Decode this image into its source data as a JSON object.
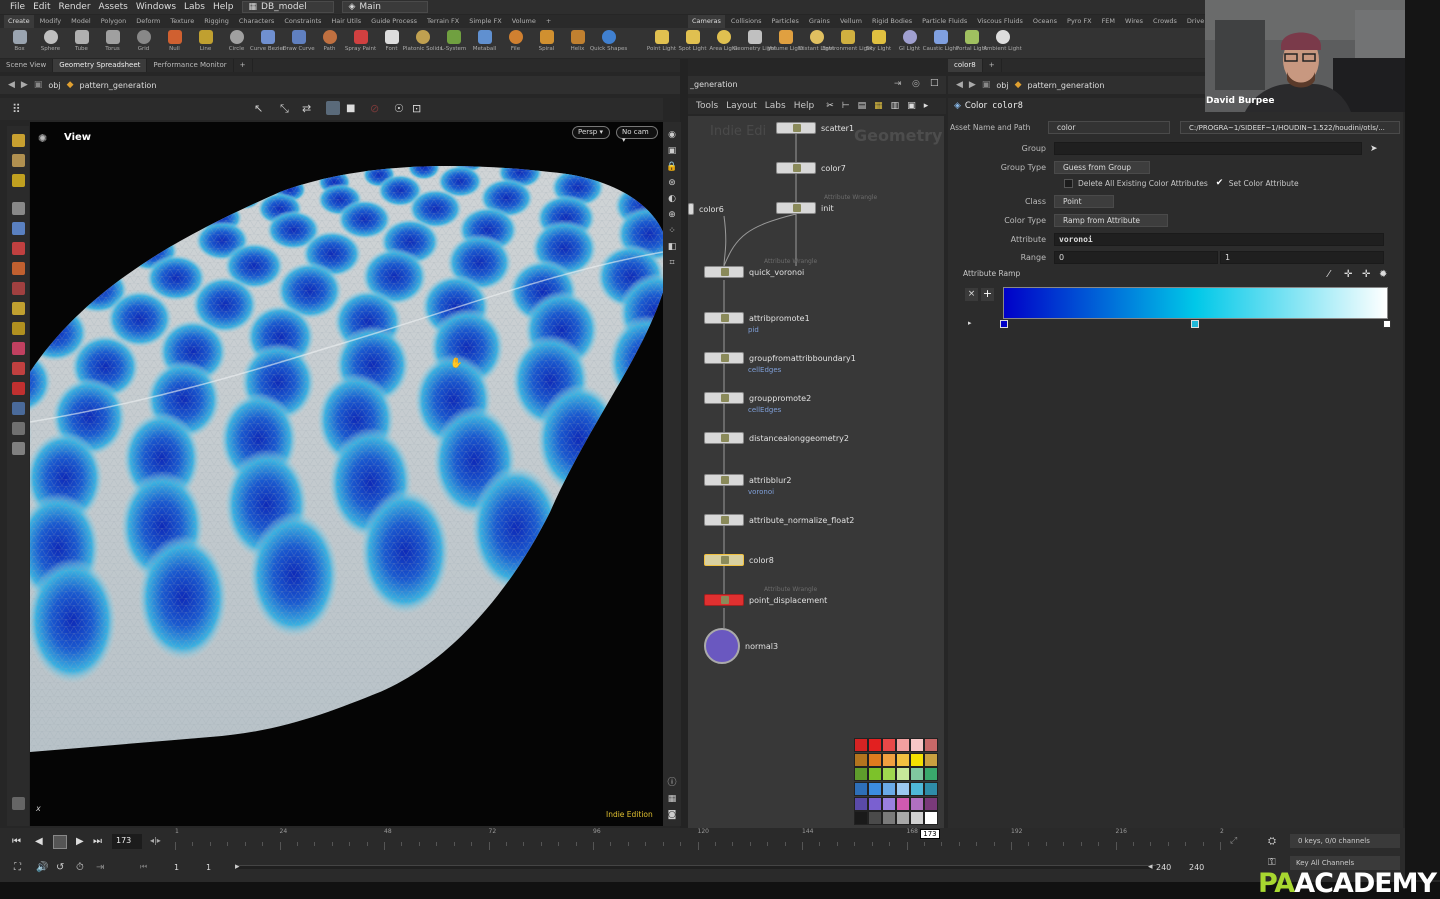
{
  "menubar": {
    "items": [
      "File",
      "Edit",
      "Render",
      "Assets",
      "Windows",
      "Labs",
      "Help"
    ],
    "desktop": "DB_model",
    "context": "Main"
  },
  "shelf_tabs_left": [
    "Create",
    "Modify",
    "Model",
    "Polygon",
    "Deform",
    "Texture",
    "Rigging",
    "Characters",
    "Constraints",
    "Hair Utils",
    "Guide Process",
    "Terrain FX",
    "Simple FX",
    "Volume"
  ],
  "shelf_tabs_right": [
    "Cameras",
    "Collisions",
    "Particles",
    "Grains",
    "Vellum",
    "Rigid Bodies",
    "Particle Fluids",
    "Viscous Fluids",
    "Oceans",
    "Pyro FX",
    "FEM",
    "Wires",
    "Crowds",
    "Drive Simu"
  ],
  "shelf_tools": [
    {
      "label": "Box",
      "icon": "box-icon"
    },
    {
      "label": "Sphere",
      "icon": "sphere-icon"
    },
    {
      "label": "Tube",
      "icon": "tube-icon"
    },
    {
      "label": "Torus",
      "icon": "torus-icon"
    },
    {
      "label": "Grid",
      "icon": "grid-icon"
    },
    {
      "label": "Null",
      "icon": "null-icon"
    },
    {
      "label": "Line",
      "icon": "line-icon"
    },
    {
      "label": "Circle",
      "icon": "circle-icon"
    },
    {
      "label": "Curve Bezier",
      "icon": "curve-bezier-icon"
    },
    {
      "label": "Draw Curve",
      "icon": "draw-curve-icon"
    },
    {
      "label": "Path",
      "icon": "path-icon"
    },
    {
      "label": "Spray Paint",
      "icon": "spray-paint-icon"
    },
    {
      "label": "Font",
      "icon": "font-icon"
    },
    {
      "label": "Platonic Solids",
      "icon": "platonic-icon"
    },
    {
      "label": "L-System",
      "icon": "lsystem-icon"
    },
    {
      "label": "Metaball",
      "icon": "metaball-icon"
    },
    {
      "label": "File",
      "icon": "file-icon"
    },
    {
      "label": "Spiral",
      "icon": "spiral-icon"
    },
    {
      "label": "Helix",
      "icon": "helix-icon"
    },
    {
      "label": "Quick Shapes",
      "icon": "quick-shapes-icon"
    },
    {
      "label": "Point Light",
      "icon": "point-light-icon"
    },
    {
      "label": "Spot Light",
      "icon": "spot-light-icon"
    },
    {
      "label": "Area Light",
      "icon": "area-light-icon"
    },
    {
      "label": "Geometry Light",
      "icon": "geometry-light-icon"
    },
    {
      "label": "Volume Light",
      "icon": "volume-light-icon"
    },
    {
      "label": "Distant Light",
      "icon": "distant-light-icon"
    },
    {
      "label": "Environment Light",
      "icon": "environment-light-icon"
    },
    {
      "label": "Sky Light",
      "icon": "sky-light-icon"
    },
    {
      "label": "GI Light",
      "icon": "gi-light-icon"
    },
    {
      "label": "Caustic Light",
      "icon": "caustic-light-icon"
    },
    {
      "label": "Portal Light",
      "icon": "portal-light-icon"
    },
    {
      "label": "Ambient Light",
      "icon": "ambient-light-icon"
    }
  ],
  "left_pane": {
    "tabs": [
      "Scene View",
      "Geometry Spreadsheet",
      "Performance Monitor"
    ],
    "path_root": "obj",
    "path_node": "pattern_generation",
    "viewport_label": "View",
    "persp": "Persp",
    "camera": "No cam",
    "watermark": "Indie Edition",
    "axis_label": "x"
  },
  "network": {
    "path_node": "_generation",
    "menu": [
      "Tools",
      "Layout",
      "Labs",
      "Help"
    ],
    "watermark_left": "Indie Edi",
    "watermark_right": "Geometry",
    "nodes": [
      {
        "name": "scatter1",
        "type": "",
        "sub": ""
      },
      {
        "name": "color7",
        "type": "",
        "sub": ""
      },
      {
        "name": "init",
        "type": "Attribute Wrangle",
        "sub": ""
      },
      {
        "name": "color6",
        "type": "",
        "sub": ""
      },
      {
        "name": "quick_voronoi",
        "type": "Attribute Wrangle",
        "sub": ""
      },
      {
        "name": "attribpromote1",
        "type": "",
        "sub": "pid"
      },
      {
        "name": "groupfromattribboundary1",
        "type": "",
        "sub": "cellEdges"
      },
      {
        "name": "grouppromote2",
        "type": "",
        "sub": "cellEdges"
      },
      {
        "name": "distancealonggeometry2",
        "type": "",
        "sub": ""
      },
      {
        "name": "attribblur2",
        "type": "",
        "sub": "voronoi"
      },
      {
        "name": "attribute_normalize_float2",
        "type": "",
        "sub": ""
      },
      {
        "name": "color8",
        "type": "",
        "sub": ""
      },
      {
        "name": "point_displacement",
        "type": "Attribute Wrangle",
        "sub": ""
      },
      {
        "name": "normal3",
        "type": "",
        "sub": ""
      }
    ],
    "palette": [
      "#d42323",
      "#e22020",
      "#e84848",
      "#f2a0a0",
      "#f7c6c6",
      "#c76868",
      "#b3741e",
      "#e07b1e",
      "#f0a040",
      "#f2c040",
      "#f4e000",
      "#c9a040",
      "#5e9c2c",
      "#7cc22a",
      "#9fd84f",
      "#c6e89a",
      "#80c8a0",
      "#3aa86c",
      "#2e6fb8",
      "#3c8ce0",
      "#6aaae8",
      "#9cc8f0",
      "#4fb8d8",
      "#2e8ca8",
      "#5a4aa8",
      "#7a60d0",
      "#9a80e0",
      "#d05ab0",
      "#b070c0",
      "#7a3a7a",
      "#1a1a1a",
      "#4a4a4a",
      "#7a7a7a",
      "#a8a8a8",
      "#d0d0d0",
      "#ffffff"
    ]
  },
  "params": {
    "tab": "color8",
    "path_root": "obj",
    "path_node": "pattern_generation",
    "node_type": "Color",
    "node_name": "color8",
    "asset_label": "Asset Name and Path",
    "asset_name": "color",
    "asset_path": "C:/PROGRA~1/SIDEEF~1/HOUDIN~1.522/houdini/otls/...",
    "group_label": "Group",
    "group_value": "",
    "group_type_label": "Group Type",
    "group_type": "Guess from Group",
    "delete_label": "Delete All Existing Color Attributes",
    "set_color_label": "Set Color Attribute",
    "class_label": "Class",
    "class_value": "Point",
    "color_type_label": "Color Type",
    "color_type": "Ramp from Attribute",
    "attribute_label": "Attribute",
    "attribute_value": "voronoi",
    "range_label": "Range",
    "range_min": "0",
    "range_max": "1",
    "ramp_label": "Attribute Ramp",
    "ramp_colors": [
      "#0000c8",
      "#00c8e8",
      "#ffffff"
    ],
    "delete_all_checked": false,
    "set_color_checked": true
  },
  "timeline": {
    "ticks": [
      "1",
      "24",
      "48",
      "72",
      "96",
      "120",
      "144",
      "168",
      "192",
      "216",
      "2"
    ],
    "current_frame": "173",
    "frame_field": "173",
    "start": "1",
    "start2": "1",
    "end": "240",
    "end2": "240",
    "keys_info": "0 keys, 0/0 channels",
    "key_all": "Key All Channels"
  },
  "webcam": {
    "name": "David Burpee"
  },
  "logo": {
    "part1": "PA",
    "part2": "ACADEMY"
  }
}
